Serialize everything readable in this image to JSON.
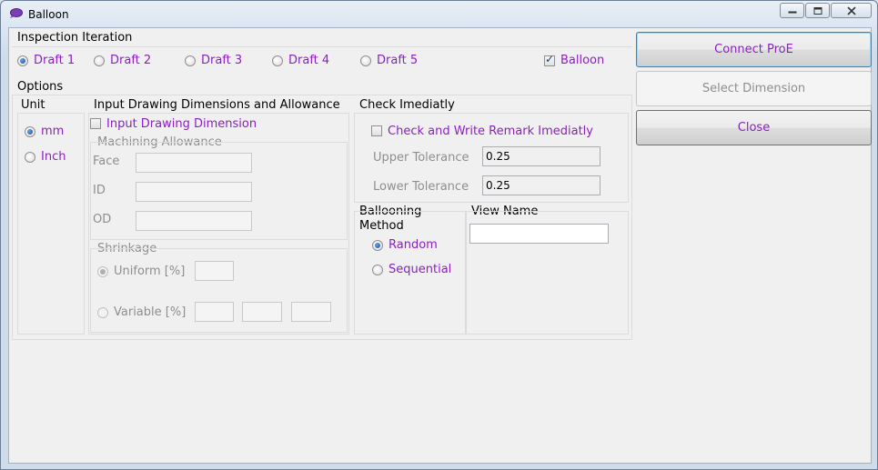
{
  "window": {
    "title": "Balloon",
    "icons": {
      "app": "speech-bubble-icon",
      "minimize": "minimize-icon",
      "maximize": "maximize-icon",
      "close": "close-icon"
    }
  },
  "inspection": {
    "title": "Inspection Iteration",
    "drafts": [
      "Draft 1",
      "Draft 2",
      "Draft 3",
      "Draft 4",
      "Draft 5"
    ],
    "selected": "Draft 1",
    "balloon_label": "Balloon",
    "balloon_checked": true
  },
  "options": {
    "title": "Options",
    "unit": {
      "title": "Unit",
      "mm": "mm",
      "inch": "Inch",
      "selected": "mm"
    },
    "input_drawing": {
      "title": "Input Drawing Dimensions and Allowance",
      "checkbox_label": "Input Drawing Dimension",
      "checkbox_checked": false,
      "machining": {
        "title": "Machining Allowance",
        "face": "Face",
        "id": "ID",
        "od": "OD"
      },
      "shrinkage": {
        "title": "Shrinkage",
        "uniform": "Uniform [%]",
        "variable": "Variable [%]",
        "selected": "Uniform [%]"
      }
    },
    "check": {
      "title": "Check Imediatly",
      "checkbox_label": "Check and Write Remark Imediatly",
      "checkbox_checked": false,
      "upper_label": "Upper Tolerance",
      "upper_value": "0.25",
      "lower_label": "Lower Tolerance",
      "lower_value": "0.25"
    },
    "ballooning": {
      "title": "Ballooning\nMethod",
      "random": "Random",
      "sequential": "Sequential",
      "selected": "Random"
    },
    "view_name": {
      "title": "View Name",
      "value": ""
    }
  },
  "buttons": {
    "connect": "Connect ProE",
    "select_dimension": "Select Dimension",
    "close": "Close"
  },
  "colors": {
    "accent_text": "#8b1fc1",
    "disabled_text": "#8e8e8e"
  }
}
